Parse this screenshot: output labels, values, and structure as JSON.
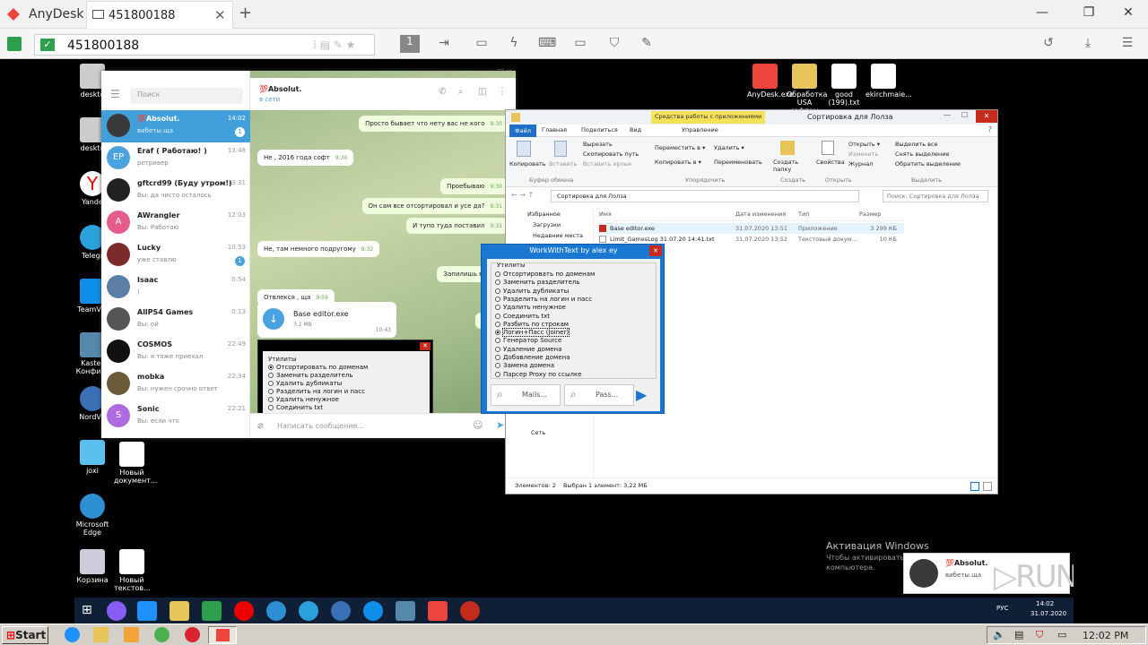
{
  "anydesk": {
    "brand": "AnyDesk",
    "tab_label": "451800188",
    "tab_close": "✕",
    "new_tab": "+",
    "address": "451800188",
    "colors": {
      "accent": "#ef443b",
      "chrome": "#f1f1f1"
    }
  },
  "desktop_icons": [
    {
      "label": "deskto"
    },
    {
      "label": "deskto"
    },
    {
      "label": "Yande"
    },
    {
      "label": "Telegr"
    },
    {
      "label": "TeamVie"
    },
    {
      "label": "Kaster Конфигу"
    },
    {
      "label": "NordVP"
    },
    {
      "label": "joxi"
    },
    {
      "label": "Новый документ..."
    },
    {
      "label": "Microsoft Edge"
    },
    {
      "label": "Корзина"
    },
    {
      "label": "Новый текстов..."
    },
    {
      "label": "AnyDesk.exe"
    },
    {
      "label": "Обработка USA софтом"
    },
    {
      "label": "good (199).txt"
    },
    {
      "label": "ekirchmaie..."
    }
  ],
  "telegram": {
    "search_placeholder": "Поиск",
    "chat_title": "💯Absolut.",
    "chat_status": "в сети",
    "input_placeholder": "Написать сообщение...",
    "chats": [
      {
        "name": "💯Absolut.",
        "msg": "вибеты.ща",
        "time": "14:02",
        "badge": "1",
        "avatar": "",
        "color": "#3a3a3a",
        "active": true
      },
      {
        "name": "Eraf ( Работаю! )",
        "msg": "ретривер",
        "time": "13:48",
        "badge": "",
        "avatar": "EP",
        "color": "#4aa2e0"
      },
      {
        "name": "gftcrd99 (Буду утром!)",
        "msg": "Вы: да чисто осталось",
        "time": "13:31",
        "badge": "",
        "avatar": "",
        "color": "#222"
      },
      {
        "name": "AWrangler",
        "msg": "Вы: Работаю",
        "time": "12:03",
        "badge": "",
        "avatar": "A",
        "color": "#e45c8b"
      },
      {
        "name": "Lucky",
        "msg": "уже ставлю",
        "time": "10:53",
        "badge": "1",
        "avatar": "",
        "color": "#7b2b2b"
      },
      {
        "name": "Isaac",
        "msg": ")",
        "time": "0:54",
        "badge": "",
        "avatar": "",
        "color": "#5b7fa6"
      },
      {
        "name": "AllPS4 Games",
        "msg": "Вы: ой",
        "time": "0:13",
        "badge": "",
        "avatar": "",
        "color": "#555"
      },
      {
        "name": "COSMOS",
        "msg": "Вы: я тоже приехал",
        "time": "22:49",
        "badge": "",
        "avatar": "",
        "color": "#111"
      },
      {
        "name": "mobka",
        "msg": "Вы: нужен срочно ответ",
        "time": "22:34",
        "badge": "",
        "avatar": "",
        "color": "#6b5b3a"
      },
      {
        "name": "Sonic",
        "msg": "Вы: если что",
        "time": "22:21",
        "badge": "",
        "avatar": "S",
        "color": "#b06adf"
      }
    ],
    "messages": [
      {
        "text": "Просто бывает что нету вас не кого",
        "time": "9:30",
        "out": true
      },
      {
        "text": "Не , 2016 года софт",
        "time": "9:30",
        "out": false
      },
      {
        "text": "Проебываю",
        "time": "9:30",
        "out": true
      },
      {
        "text": "Он сам все отсортировал и усе да?",
        "time": "9:31",
        "out": true
      },
      {
        "text": "И тупо туда поставил",
        "time": "9:31",
        "out": true
      },
      {
        "text": "Не, там немного подругому",
        "time": "9:32",
        "out": false
      },
      {
        "text": "Запилишь видео?",
        "time": "",
        "out": true
      },
      {
        "text": "Отвлекся , ща",
        "time": "9:59",
        "out": false
      },
      {
        "text": "Ну чо)",
        "time": "",
        "out": true
      }
    ],
    "file": {
      "name": "Base editor.exe",
      "size": "3.2 MB",
      "time": "10:43"
    },
    "preview": {
      "group": "Утилиты",
      "options": [
        "Отсортировать по доменам",
        "Заменить разделитель",
        "Удалить дубликаты",
        "Разделить на логин и пасс",
        "Удалить ненужное",
        "Соединить txt"
      ]
    }
  },
  "explorer": {
    "title": "Сортировка для Лолза",
    "context_tab": "Средства работы с приложениями",
    "tabs": [
      "Файл",
      "Главная",
      "Поделиться",
      "Вид",
      "Управление"
    ],
    "ribbon": {
      "copy": "Копировать",
      "paste": "Вставить",
      "cut": "Вырезать",
      "copy_path": "Скопировать путь",
      "paste_link": "Вставить ярлык",
      "move_to": "Переместить в ▾",
      "copy_to": "Копировать в ▾",
      "delete": "Удалить ▾",
      "rename": "Переименовать",
      "new_folder": "Создать папку",
      "properties": "Свойства",
      "open": "Открыть ▾",
      "edit": "Изменить",
      "history": "Журнал",
      "select_all": "Выделить все",
      "select_none": "Снять выделение",
      "invert": "Обратить выделение",
      "groups": [
        "Буфер обмена",
        "Упорядочить",
        "Создать",
        "Открыть",
        "Выделить"
      ]
    },
    "path": "Сортировка для Лолза",
    "search_placeholder": "Поиск: Сортировка для Лолза",
    "nav": [
      "Избранное",
      "Загрузки",
      "Недавние места",
      "Сеть"
    ],
    "columns": [
      "Имя",
      "Дата изменения",
      "Тип",
      "Размер"
    ],
    "files": [
      {
        "name": "Base editor.exe",
        "date": "31.07.2020 13:51",
        "type": "Приложение",
        "size": "3 299 КБ"
      },
      {
        "name": "Limit_GamesLog 31.07.20 14:41.txt",
        "date": "31.07.2020 13:52",
        "type": "Текстовый докум...",
        "size": "10 КБ"
      }
    ],
    "status_count": "Элементов: 2",
    "status_selected": "Выбран 1 элемент: 3,22 МБ"
  },
  "wwt": {
    "title": "WorkWithText by alex ey",
    "group": "Утилиты",
    "options": [
      "Отсортировать по доменам",
      "Заменить разделитель",
      "Удалить дубликаты",
      "Разделить на логин и пасс",
      "Удалить ненужное",
      "Соединить txt",
      "Разбить по строкам",
      "Логин+Пасс (Joiner)",
      "Генератор Source",
      "Удаление домена",
      "Добавление домена",
      "Замена домена",
      "Парсер Proxy по ссылке"
    ],
    "selected_index": 7,
    "mails_btn": "Mails...",
    "pass_btn": "Pass..."
  },
  "watermark": {
    "line1": "Активация Windows",
    "line2": "Чтобы активировать Windows, перейдите в раздел «Параметры»",
    "line3": "компьютера."
  },
  "notification": {
    "title": "💯Absolut.",
    "text": "вибеты.ща"
  },
  "remote_tray": {
    "lang": "РУС",
    "time": "14:02",
    "date": "31.07.2020"
  },
  "host_taskbar": {
    "start": "Start",
    "time": "12:02 PM"
  }
}
